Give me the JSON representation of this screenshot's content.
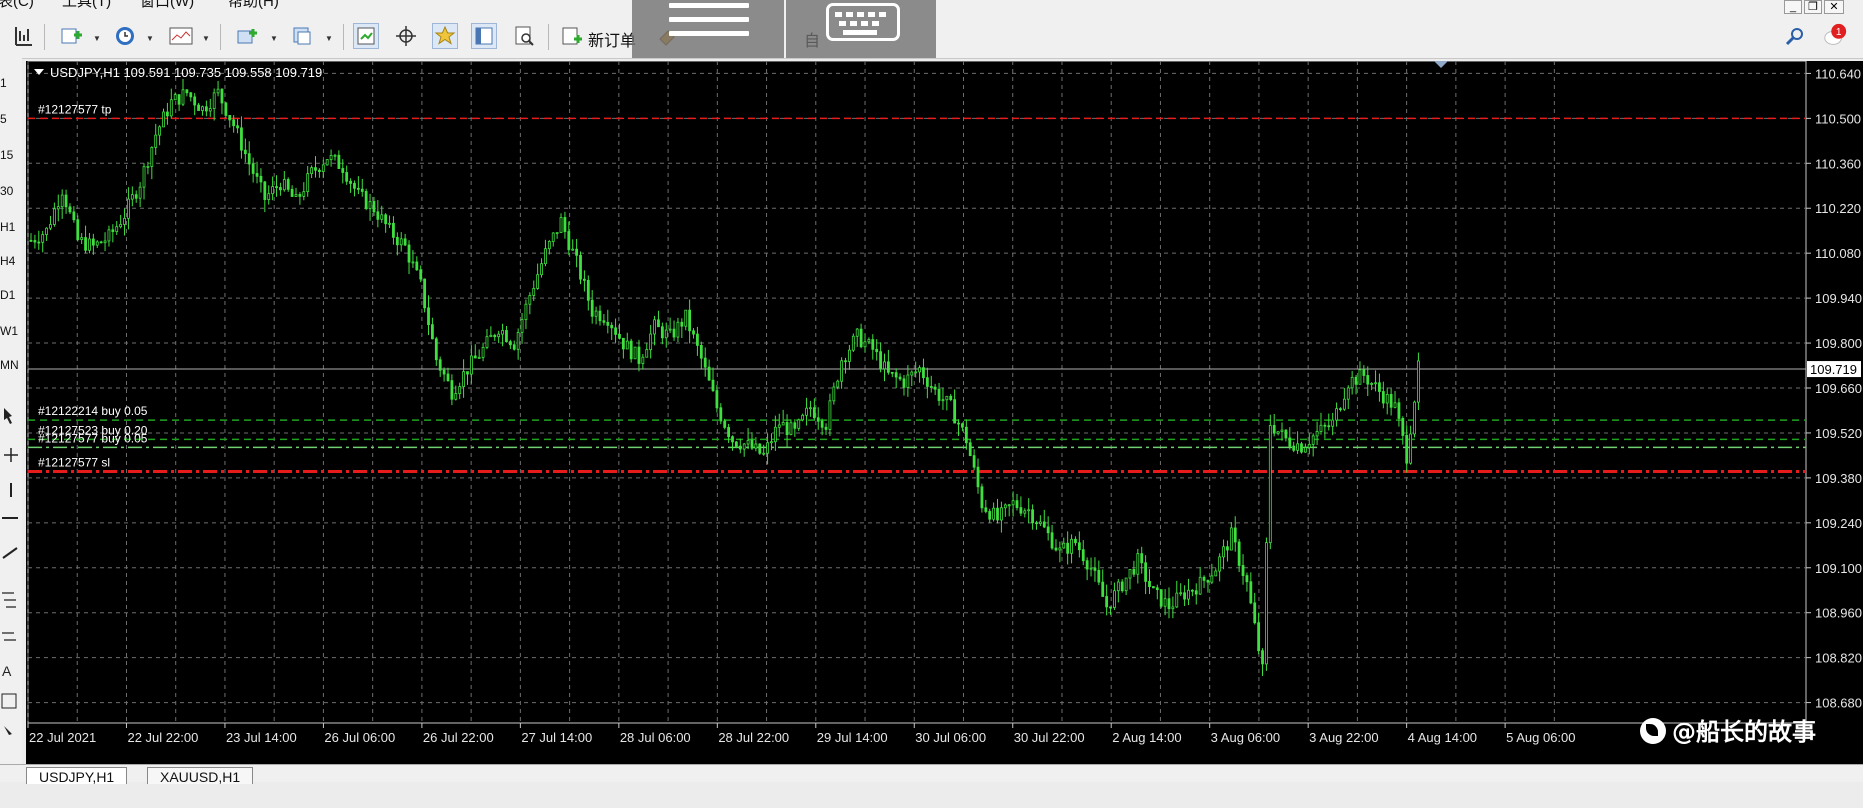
{
  "menu": {
    "items": [
      "表(C)",
      "工具(T)",
      "窗口(W)",
      "帮助(H)"
    ]
  },
  "toolbar": {
    "new_order_label": "新订单",
    "auto_label": "自"
  },
  "notification_count": "1",
  "left_strip": {
    "items": [
      "1",
      "5",
      "15",
      "30",
      "H1",
      "H4",
      "D1",
      "W1",
      "MN"
    ]
  },
  "chart": {
    "header": "USDJPY,H1  109.591 109.735 109.558 109.719",
    "current_price": "109.719",
    "lines": [
      {
        "label": "#12127577 tp",
        "price": 110.5,
        "color": "#e81b1b",
        "style": "dash"
      },
      {
        "label": "#12122214 buy 0.05",
        "price": 109.56,
        "color": "#1fa31f",
        "style": "dash"
      },
      {
        "label": "#12127523 buy 0.20",
        "price": 109.5,
        "color": "#1fa31f",
        "style": "dash"
      },
      {
        "label": "#12127577 buy 0.05",
        "price": 109.475,
        "color": "#6fd06f",
        "style": "dashdot"
      },
      {
        "label": "#12127577 sl",
        "price": 109.4,
        "color": "#e81b1b",
        "style": "dashdot"
      }
    ]
  },
  "chart_data": {
    "type": "candlestick",
    "symbol": "USDJPY",
    "timeframe": "H1",
    "y_axis_ticks": [
      "110.640",
      "110.500",
      "110.360",
      "110.220",
      "110.080",
      "109.940",
      "109.800",
      "109.660",
      "109.520",
      "109.380",
      "109.240",
      "109.100",
      "108.960",
      "108.820",
      "108.680"
    ],
    "ylim": [
      108.66,
      110.66
    ],
    "x_axis_ticks": [
      "22 Jul 2021",
      "22 Jul 22:00",
      "23 Jul 14:00",
      "26 Jul 06:00",
      "26 Jul 22:00",
      "27 Jul 14:00",
      "28 Jul 06:00",
      "28 Jul 22:00",
      "29 Jul 14:00",
      "30 Jul 06:00",
      "30 Jul 22:00",
      "2 Aug 14:00",
      "3 Aug 06:00",
      "3 Aug 22:00",
      "4 Aug 14:00",
      "5 Aug 06:00"
    ],
    "series_color": "#3fe03f",
    "approx_close_path": [
      [
        0,
        110.12
      ],
      [
        4,
        110.15
      ],
      [
        8,
        110.28
      ],
      [
        12,
        110.12
      ],
      [
        16,
        110.1
      ],
      [
        20,
        110.13
      ],
      [
        24,
        110.2
      ],
      [
        28,
        110.3
      ],
      [
        32,
        110.45
      ],
      [
        36,
        110.55
      ],
      [
        40,
        110.58
      ],
      [
        44,
        110.53
      ],
      [
        48,
        110.58
      ],
      [
        52,
        110.48
      ],
      [
        56,
        110.36
      ],
      [
        60,
        110.25
      ],
      [
        64,
        110.3
      ],
      [
        68,
        110.24
      ],
      [
        72,
        110.33
      ],
      [
        76,
        110.38
      ],
      [
        80,
        110.35
      ],
      [
        84,
        110.26
      ],
      [
        88,
        110.22
      ],
      [
        92,
        110.15
      ],
      [
        96,
        110.1
      ],
      [
        100,
        109.98
      ],
      [
        104,
        109.75
      ],
      [
        108,
        109.65
      ],
      [
        112,
        109.72
      ],
      [
        116,
        109.78
      ],
      [
        120,
        109.85
      ],
      [
        124,
        109.8
      ],
      [
        128,
        109.95
      ],
      [
        132,
        110.08
      ],
      [
        136,
        110.18
      ],
      [
        140,
        110.05
      ],
      [
        144,
        109.9
      ],
      [
        148,
        109.88
      ],
      [
        152,
        109.8
      ],
      [
        156,
        109.75
      ],
      [
        160,
        109.85
      ],
      [
        164,
        109.82
      ],
      [
        168,
        109.88
      ],
      [
        172,
        109.75
      ],
      [
        176,
        109.6
      ],
      [
        180,
        109.5
      ],
      [
        184,
        109.48
      ],
      [
        188,
        109.45
      ],
      [
        192,
        109.55
      ],
      [
        196,
        109.52
      ],
      [
        200,
        109.6
      ],
      [
        204,
        109.55
      ],
      [
        208,
        109.75
      ],
      [
        212,
        109.82
      ],
      [
        216,
        109.78
      ],
      [
        220,
        109.7
      ],
      [
        224,
        109.68
      ],
      [
        228,
        109.72
      ],
      [
        232,
        109.65
      ],
      [
        236,
        109.6
      ],
      [
        240,
        109.5
      ],
      [
        244,
        109.3
      ],
      [
        248,
        109.25
      ],
      [
        252,
        109.3
      ],
      [
        256,
        109.28
      ],
      [
        260,
        109.22
      ],
      [
        264,
        109.15
      ],
      [
        268,
        109.18
      ],
      [
        272,
        109.1
      ],
      [
        276,
        108.98
      ],
      [
        280,
        109.05
      ],
      [
        284,
        109.12
      ],
      [
        288,
        109.02
      ],
      [
        292,
        108.98
      ],
      [
        296,
        109.02
      ],
      [
        300,
        109.05
      ],
      [
        304,
        109.1
      ],
      [
        308,
        109.2
      ],
      [
        312,
        109.05
      ],
      [
        316,
        108.78
      ],
      [
        318,
        109.55
      ],
      [
        322,
        109.5
      ],
      [
        326,
        109.48
      ],
      [
        330,
        109.52
      ],
      [
        334,
        109.55
      ],
      [
        338,
        109.68
      ],
      [
        342,
        109.7
      ],
      [
        346,
        109.65
      ],
      [
        350,
        109.6
      ],
      [
        353,
        109.45
      ],
      [
        356,
        109.72
      ]
    ]
  },
  "watermark": "@船长的故事",
  "tabs": [
    "USDJPY,H1",
    "XAUUSD,H1"
  ]
}
